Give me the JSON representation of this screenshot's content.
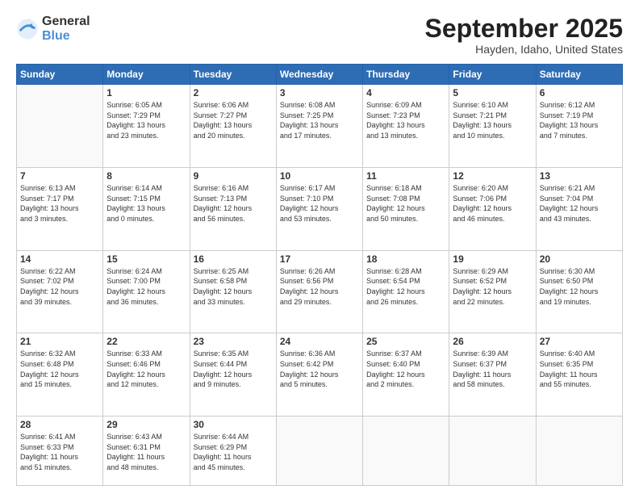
{
  "logo": {
    "general": "General",
    "blue": "Blue"
  },
  "header": {
    "month": "September 2025",
    "location": "Hayden, Idaho, United States"
  },
  "days_header": [
    "Sunday",
    "Monday",
    "Tuesday",
    "Wednesday",
    "Thursday",
    "Friday",
    "Saturday"
  ],
  "weeks": [
    [
      {
        "day": "",
        "info": ""
      },
      {
        "day": "1",
        "info": "Sunrise: 6:05 AM\nSunset: 7:29 PM\nDaylight: 13 hours\nand 23 minutes."
      },
      {
        "day": "2",
        "info": "Sunrise: 6:06 AM\nSunset: 7:27 PM\nDaylight: 13 hours\nand 20 minutes."
      },
      {
        "day": "3",
        "info": "Sunrise: 6:08 AM\nSunset: 7:25 PM\nDaylight: 13 hours\nand 17 minutes."
      },
      {
        "day": "4",
        "info": "Sunrise: 6:09 AM\nSunset: 7:23 PM\nDaylight: 13 hours\nand 13 minutes."
      },
      {
        "day": "5",
        "info": "Sunrise: 6:10 AM\nSunset: 7:21 PM\nDaylight: 13 hours\nand 10 minutes."
      },
      {
        "day": "6",
        "info": "Sunrise: 6:12 AM\nSunset: 7:19 PM\nDaylight: 13 hours\nand 7 minutes."
      }
    ],
    [
      {
        "day": "7",
        "info": "Sunrise: 6:13 AM\nSunset: 7:17 PM\nDaylight: 13 hours\nand 3 minutes."
      },
      {
        "day": "8",
        "info": "Sunrise: 6:14 AM\nSunset: 7:15 PM\nDaylight: 13 hours\nand 0 minutes."
      },
      {
        "day": "9",
        "info": "Sunrise: 6:16 AM\nSunset: 7:13 PM\nDaylight: 12 hours\nand 56 minutes."
      },
      {
        "day": "10",
        "info": "Sunrise: 6:17 AM\nSunset: 7:10 PM\nDaylight: 12 hours\nand 53 minutes."
      },
      {
        "day": "11",
        "info": "Sunrise: 6:18 AM\nSunset: 7:08 PM\nDaylight: 12 hours\nand 50 minutes."
      },
      {
        "day": "12",
        "info": "Sunrise: 6:20 AM\nSunset: 7:06 PM\nDaylight: 12 hours\nand 46 minutes."
      },
      {
        "day": "13",
        "info": "Sunrise: 6:21 AM\nSunset: 7:04 PM\nDaylight: 12 hours\nand 43 minutes."
      }
    ],
    [
      {
        "day": "14",
        "info": "Sunrise: 6:22 AM\nSunset: 7:02 PM\nDaylight: 12 hours\nand 39 minutes."
      },
      {
        "day": "15",
        "info": "Sunrise: 6:24 AM\nSunset: 7:00 PM\nDaylight: 12 hours\nand 36 minutes."
      },
      {
        "day": "16",
        "info": "Sunrise: 6:25 AM\nSunset: 6:58 PM\nDaylight: 12 hours\nand 33 minutes."
      },
      {
        "day": "17",
        "info": "Sunrise: 6:26 AM\nSunset: 6:56 PM\nDaylight: 12 hours\nand 29 minutes."
      },
      {
        "day": "18",
        "info": "Sunrise: 6:28 AM\nSunset: 6:54 PM\nDaylight: 12 hours\nand 26 minutes."
      },
      {
        "day": "19",
        "info": "Sunrise: 6:29 AM\nSunset: 6:52 PM\nDaylight: 12 hours\nand 22 minutes."
      },
      {
        "day": "20",
        "info": "Sunrise: 6:30 AM\nSunset: 6:50 PM\nDaylight: 12 hours\nand 19 minutes."
      }
    ],
    [
      {
        "day": "21",
        "info": "Sunrise: 6:32 AM\nSunset: 6:48 PM\nDaylight: 12 hours\nand 15 minutes."
      },
      {
        "day": "22",
        "info": "Sunrise: 6:33 AM\nSunset: 6:46 PM\nDaylight: 12 hours\nand 12 minutes."
      },
      {
        "day": "23",
        "info": "Sunrise: 6:35 AM\nSunset: 6:44 PM\nDaylight: 12 hours\nand 9 minutes."
      },
      {
        "day": "24",
        "info": "Sunrise: 6:36 AM\nSunset: 6:42 PM\nDaylight: 12 hours\nand 5 minutes."
      },
      {
        "day": "25",
        "info": "Sunrise: 6:37 AM\nSunset: 6:40 PM\nDaylight: 12 hours\nand 2 minutes."
      },
      {
        "day": "26",
        "info": "Sunrise: 6:39 AM\nSunset: 6:37 PM\nDaylight: 11 hours\nand 58 minutes."
      },
      {
        "day": "27",
        "info": "Sunrise: 6:40 AM\nSunset: 6:35 PM\nDaylight: 11 hours\nand 55 minutes."
      }
    ],
    [
      {
        "day": "28",
        "info": "Sunrise: 6:41 AM\nSunset: 6:33 PM\nDaylight: 11 hours\nand 51 minutes."
      },
      {
        "day": "29",
        "info": "Sunrise: 6:43 AM\nSunset: 6:31 PM\nDaylight: 11 hours\nand 48 minutes."
      },
      {
        "day": "30",
        "info": "Sunrise: 6:44 AM\nSunset: 6:29 PM\nDaylight: 11 hours\nand 45 minutes."
      },
      {
        "day": "",
        "info": ""
      },
      {
        "day": "",
        "info": ""
      },
      {
        "day": "",
        "info": ""
      },
      {
        "day": "",
        "info": ""
      }
    ]
  ]
}
